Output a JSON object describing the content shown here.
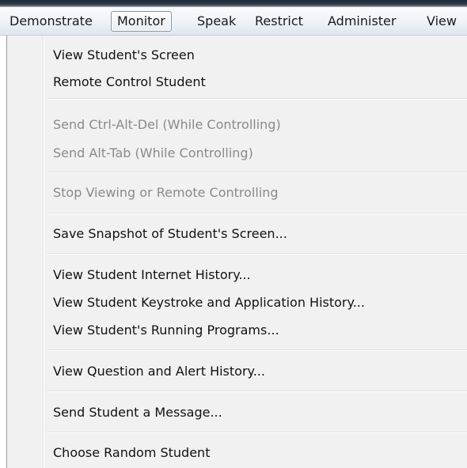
{
  "menubar": {
    "items": [
      {
        "label": "Demonstrate"
      },
      {
        "label": "Monitor"
      },
      {
        "label": "Speak"
      },
      {
        "label": "Restrict"
      },
      {
        "label": "Administer"
      },
      {
        "label": "View"
      }
    ],
    "active": "Monitor"
  },
  "dropdown": {
    "items": [
      {
        "label": "View Student's Screen",
        "enabled": true
      },
      {
        "label": "Remote Control Student",
        "enabled": true
      },
      {
        "label": "Send Ctrl-Alt-Del (While Controlling)",
        "enabled": false
      },
      {
        "label": "Send Alt-Tab (While Controlling)",
        "enabled": false
      },
      {
        "label": "Stop Viewing or Remote Controlling",
        "enabled": false
      },
      {
        "label": "Save Snapshot of Student's Screen...",
        "enabled": true
      },
      {
        "label": "View Student Internet History...",
        "enabled": true
      },
      {
        "label": "View Student Keystroke and Application History...",
        "enabled": true
      },
      {
        "label": "View Student's Running Programs...",
        "enabled": true
      },
      {
        "label": "View Question and Alert History...",
        "enabled": true
      },
      {
        "label": "Send Student a Message...",
        "enabled": true
      },
      {
        "label": "Choose Random Student",
        "enabled": true
      }
    ]
  },
  "colors": {
    "enabled_text": "#121212",
    "disabled_text": "#8a8a8a",
    "menu_background": "#f1f1f1"
  }
}
